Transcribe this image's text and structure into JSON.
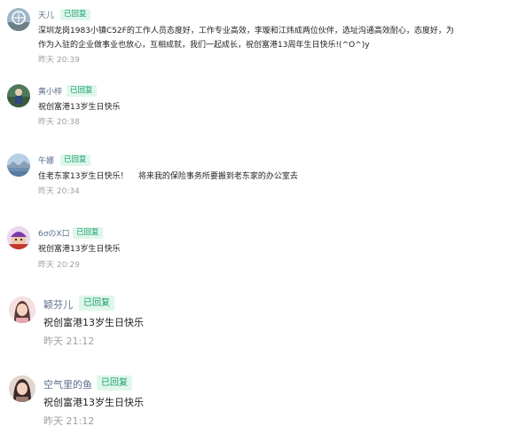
{
  "badge_label": "已回复",
  "comments": [
    {
      "name": "天儿",
      "text": "深圳龙岗1983小镇C52F的工作人员态度好，工作专业高效，李璇和江炜成两位伙伴，选址沟通高效耐心，态度好，为",
      "text2": "作为入驻的企业做事业也放心，互相成就，我们一起成长，祝创富港13周年生日快乐!(^O^)y",
      "time": "昨天 20:39",
      "avatar_icon": "ferris-wheel-avatar-icon"
    },
    {
      "name": "黄小梓",
      "text": "祝创富港13岁生日快乐",
      "time": "昨天 20:38",
      "avatar_icon": "outdoor-figure-avatar-icon"
    },
    {
      "name": "午娜",
      "text": "住老东家13岁生日快乐！    将来我的保险事务所要搬到老东家的办公室去",
      "time": "昨天 20:34",
      "avatar_icon": "landscape-avatar-icon"
    },
    {
      "name": "6σのX口",
      "text": "祝创富港13岁生日快乐",
      "time": "昨天 20:29",
      "avatar_icon": "cartoon-character-avatar-icon"
    },
    {
      "name": "颖芬儿",
      "text": "祝创富港13岁生日快乐",
      "time": "昨天 21:12",
      "avatar_icon": "woman-portrait-avatar-icon"
    },
    {
      "name": "空气里的鱼",
      "text": "祝创富港13岁生日快乐",
      "time": "昨天 21:12",
      "avatar_icon": "girl-portrait-avatar-icon"
    }
  ]
}
